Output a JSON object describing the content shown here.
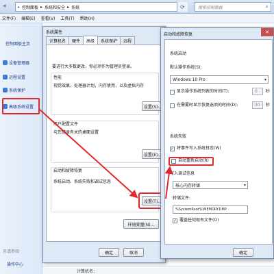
{
  "explorer": {
    "breadcrumb": [
      "控制面板",
      "系统和安全",
      "系统"
    ],
    "search_placeholder": "搜索控制面板",
    "menu": [
      "文件(F)",
      "编辑(E)",
      "查看(V)",
      "工具(T)",
      "帮助(H)"
    ],
    "left_home": "控制面板主页",
    "left_links": [
      "设备管理器",
      "远程设置",
      "系统保护",
      "高级系统设置"
    ],
    "see_also": "另请参阅",
    "action_center": "操作中心",
    "bottom_text": "计算机名："
  },
  "system_properties": {
    "title": "系统属性",
    "tabs": [
      "计算机名",
      "硬件",
      "高级",
      "系统保护",
      "远程"
    ],
    "active_tab": "高级",
    "admin_note": "要进行大多数更改，你必须作为管理员登录。",
    "performance": {
      "label": "性能",
      "desc": "视觉效果，处理器计划，内存使用，以及虚拟内存",
      "button": "设置(S)..."
    },
    "profiles": {
      "label": "用户配置文件",
      "desc": "与您登录有关的桌面设置",
      "button": "设置(E)..."
    },
    "startup_recovery": {
      "label": "启动和故障恢复",
      "desc": "系统启动、系统失败和调试信息",
      "button": "设置(T)..."
    },
    "env_button": "环境变量(N)...",
    "ok": "确定",
    "cancel": "取消"
  },
  "startup_recovery": {
    "title": "启动和故障恢复",
    "system_startup": "系统启动",
    "default_os_label": "默认操作系统(S):",
    "default_os": "Windows 10 Pro",
    "show_os_list": "显示操作系统列表的时间(T):",
    "show_os_list_value": "0",
    "show_recovery": "在需要时显示恢复选项的时间(D):",
    "show_recovery_value": "30",
    "seconds": "秒",
    "system_failure": "系统失败",
    "write_event": "将事件写入系统日志(W)",
    "auto_restart": "自动重新启动(R)",
    "debug_info": "写入调试信息",
    "dump_type": "核心内存转储",
    "dump_file_label": "转储文件:",
    "dump_file": "%SystemRoot%\\MEMORY.DMP",
    "overwrite": "覆盖任何现有文件(O)",
    "ok": "确定"
  },
  "colors": {
    "highlight": "#e0282e",
    "link": "#1e3f8a"
  }
}
